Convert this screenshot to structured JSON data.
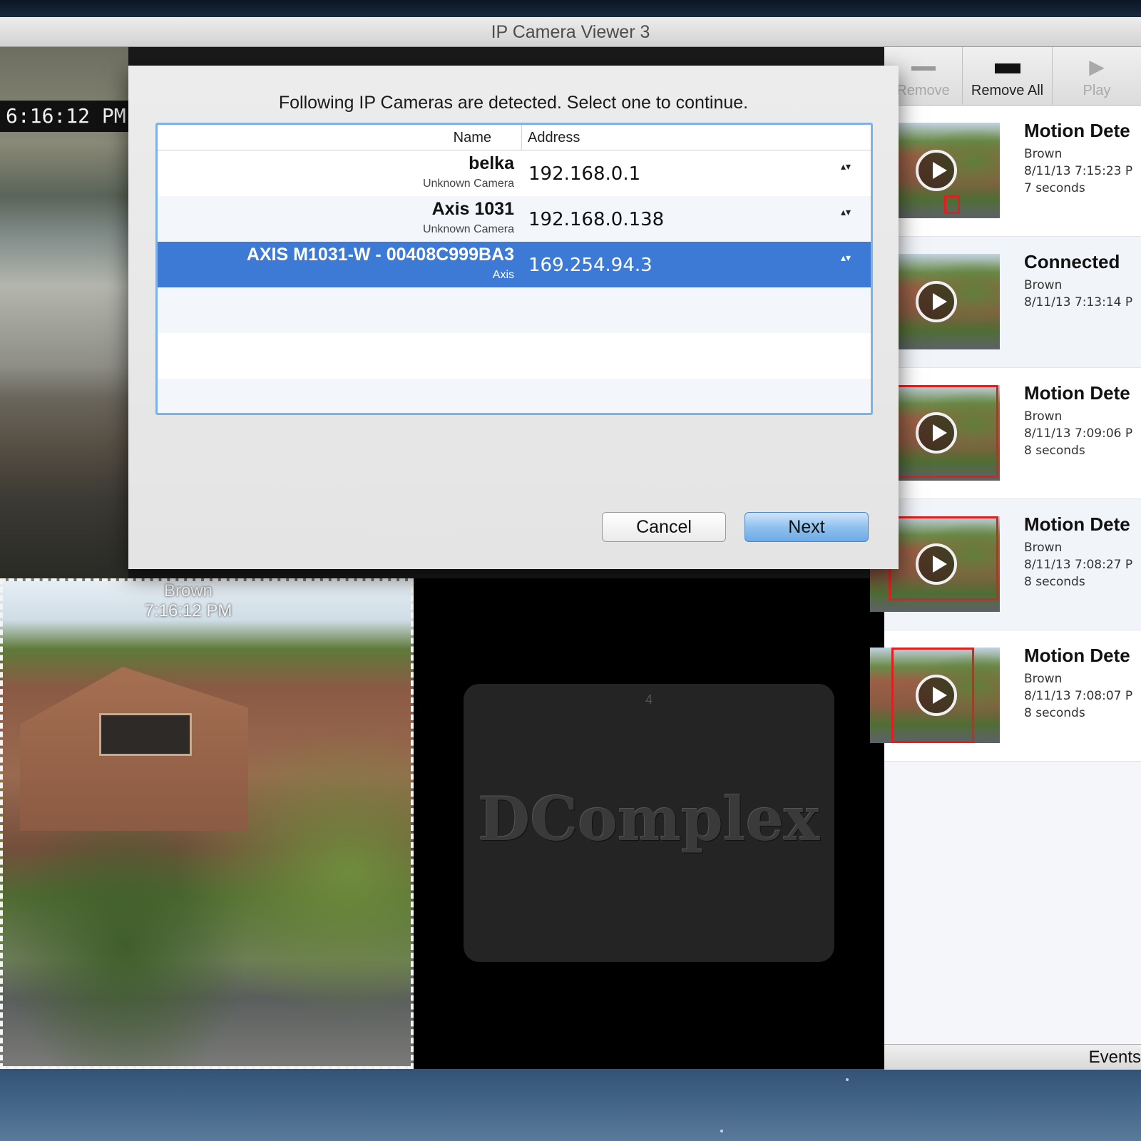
{
  "window": {
    "title": "IP Camera Viewer 3"
  },
  "feeds": {
    "top_left": {
      "time": "6:16:12 PM"
    },
    "bottom_left": {
      "label": "Brown",
      "time": "7:16:12 PM"
    },
    "bottom_right": {
      "slot": "4",
      "logo": "DComplex"
    }
  },
  "sheet": {
    "prompt": "Following IP Cameras are detected. Select one to continue.",
    "columns": {
      "name": "Name",
      "address": "Address"
    },
    "rows": [
      {
        "name": "belka",
        "type": "Unknown Camera",
        "address": "192.168.0.1",
        "selected": false
      },
      {
        "name": "Axis 1031",
        "type": "Unknown Camera",
        "address": "192.168.0.138",
        "selected": false
      },
      {
        "name": "AXIS M1031-W - 00408C999BA3",
        "type": "Axis",
        "address": "169.254.94.3",
        "selected": true
      }
    ],
    "stepper_glyph": "▴▾",
    "cancel_label": "Cancel",
    "next_label": "Next"
  },
  "sidebar": {
    "toolbar": {
      "remove_label": "Remove",
      "remove_all_label": "Remove All",
      "play_label": "Play"
    },
    "events": [
      {
        "title": "Motion Dete",
        "camera": "Brown",
        "datetime": "8/11/13 7:15:23 P",
        "duration": "7 seconds"
      },
      {
        "title": "Connected",
        "camera": "Brown",
        "datetime": "8/11/13 7:13:14 P",
        "duration": ""
      },
      {
        "title": "Motion Dete",
        "camera": "Brown",
        "datetime": "8/11/13 7:09:06 P",
        "duration": "8 seconds"
      },
      {
        "title": "Motion Dete",
        "camera": "Brown",
        "datetime": "8/11/13 7:08:27 P",
        "duration": "8 seconds"
      },
      {
        "title": "Motion Dete",
        "camera": "Brown",
        "datetime": "8/11/13 7:08:07 P",
        "duration": "8 seconds"
      }
    ],
    "footer_label": "Events"
  },
  "colors": {
    "selection": "#3d7ad6",
    "list_border": "#7fb0e6",
    "motion_box": "#e02020"
  }
}
